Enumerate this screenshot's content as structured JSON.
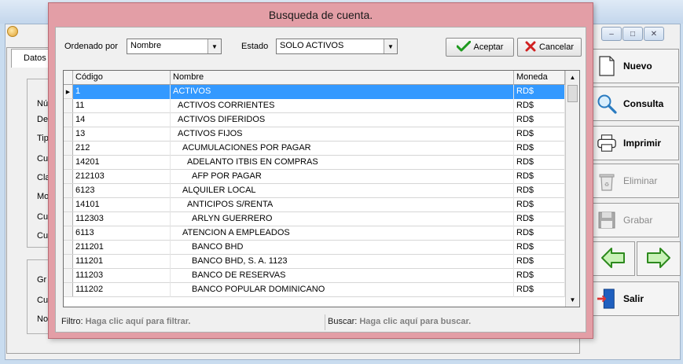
{
  "background": {
    "tab_label": "Datos",
    "field_labels": [
      "Nú",
      "De",
      "Tip",
      "Cu",
      "Cla",
      "Mo",
      "Cu",
      "Cu"
    ],
    "group2_labels": [
      "Gr",
      "Cu",
      "No"
    ],
    "window_controls": [
      "minimize",
      "maximize",
      "close"
    ]
  },
  "sidebar": {
    "nuevo": "Nuevo",
    "consulta": "Consulta",
    "imprimir": "Imprimir",
    "eliminar": "Eliminar",
    "grabar": "Grabar",
    "salir": "Salir"
  },
  "dialog": {
    "title": "Busqueda de cuenta.",
    "ordenado_label": "Ordenado por",
    "ordenado_value": "Nombre",
    "estado_label": "Estado",
    "estado_value": "SOLO ACTIVOS",
    "aceptar": "Aceptar",
    "cancelar": "Cancelar",
    "columns": {
      "codigo": "Código",
      "nombre": "Nombre",
      "moneda": "Moneda"
    },
    "rows": [
      {
        "code": "1",
        "name": "ACTIVOS",
        "indent": 0,
        "currency": "RD$",
        "selected": true
      },
      {
        "code": "11",
        "name": "ACTIVOS CORRIENTES",
        "indent": 1,
        "currency": "RD$"
      },
      {
        "code": "14",
        "name": "ACTIVOS DIFERIDOS",
        "indent": 1,
        "currency": "RD$"
      },
      {
        "code": "13",
        "name": "ACTIVOS FIJOS",
        "indent": 1,
        "currency": "RD$"
      },
      {
        "code": "212",
        "name": "ACUMULACIONES POR PAGAR",
        "indent": 2,
        "currency": "RD$"
      },
      {
        "code": "14201",
        "name": "ADELANTO ITBIS EN COMPRAS",
        "indent": 3,
        "currency": "RD$"
      },
      {
        "code": "212103",
        "name": "AFP POR PAGAR",
        "indent": 4,
        "currency": "RD$"
      },
      {
        "code": "6123",
        "name": "ALQUILER LOCAL",
        "indent": 2,
        "currency": "RD$"
      },
      {
        "code": "14101",
        "name": "ANTICIPOS S/RENTA",
        "indent": 3,
        "currency": "RD$"
      },
      {
        "code": "112303",
        "name": "ARLYN GUERRERO",
        "indent": 4,
        "currency": "RD$"
      },
      {
        "code": "6113",
        "name": "ATENCION A EMPLEADOS",
        "indent": 2,
        "currency": "RD$"
      },
      {
        "code": "211201",
        "name": "BANCO BHD",
        "indent": 4,
        "currency": "RD$"
      },
      {
        "code": "111201",
        "name": "BANCO BHD, S. A. 1123",
        "indent": 4,
        "currency": "RD$"
      },
      {
        "code": "111203",
        "name": "BANCO DE RESERVAS",
        "indent": 4,
        "currency": "RD$"
      },
      {
        "code": "111202",
        "name": "BANCO POPULAR DOMINICANO",
        "indent": 4,
        "currency": "RD$"
      }
    ],
    "filtro_label": "Filtro:",
    "filtro_hint": "Haga clic aquí para filtrar.",
    "buscar_label": "Buscar:",
    "buscar_hint": "Haga clic aquí para buscar."
  },
  "colors": {
    "dialog_frame": "#e39ea6",
    "selection": "#3399ff"
  }
}
